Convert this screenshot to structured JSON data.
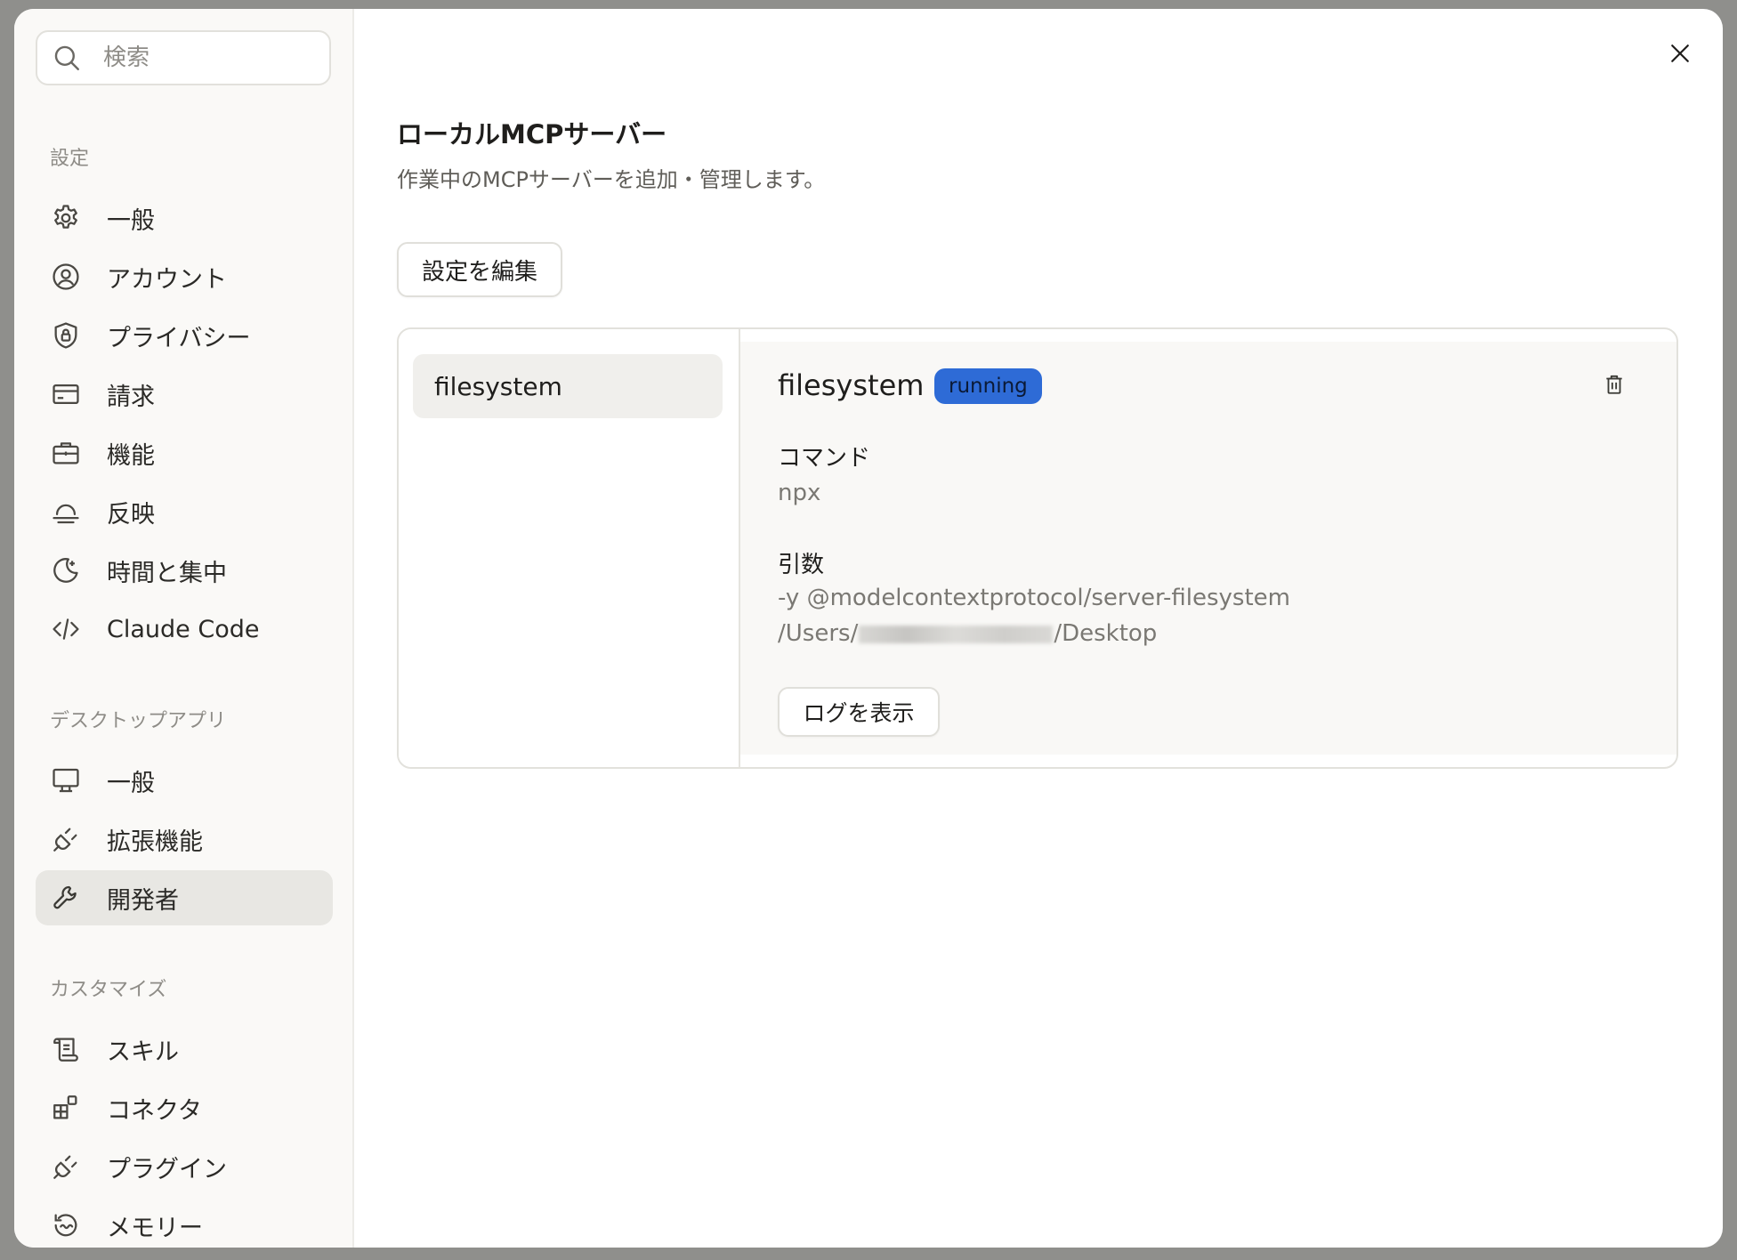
{
  "search": {
    "placeholder": "検索"
  },
  "sidebar": {
    "sections": [
      {
        "title": "設定",
        "items": [
          {
            "label": "一般",
            "icon": "gear-icon"
          },
          {
            "label": "アカウント",
            "icon": "user-circle-icon"
          },
          {
            "label": "プライバシー",
            "icon": "shield-lock-icon"
          },
          {
            "label": "請求",
            "icon": "credit-card-icon"
          },
          {
            "label": "機能",
            "icon": "briefcase-icon"
          },
          {
            "label": "反映",
            "icon": "sunset-icon"
          },
          {
            "label": "時間と集中",
            "icon": "moon-sparkle-icon"
          },
          {
            "label": "Claude Code",
            "icon": "code-icon"
          }
        ]
      },
      {
        "title": "デスクトップアプリ",
        "items": [
          {
            "label": "一般",
            "icon": "monitor-icon"
          },
          {
            "label": "拡張機能",
            "icon": "plug-icon"
          },
          {
            "label": "開発者",
            "icon": "wrench-icon",
            "active": true
          }
        ]
      },
      {
        "title": "カスタマイズ",
        "items": [
          {
            "label": "スキル",
            "icon": "scroll-icon"
          },
          {
            "label": "コネクタ",
            "icon": "blocks-icon"
          },
          {
            "label": "プラグイン",
            "icon": "plug-icon"
          },
          {
            "label": "メモリー",
            "icon": "history-icon"
          }
        ]
      }
    ]
  },
  "main": {
    "title": "ローカルMCPサーバー",
    "description": "作業中のMCPサーバーを追加・管理します。",
    "edit_button": "設定を編集",
    "servers": [
      {
        "name": "filesystem"
      }
    ],
    "detail": {
      "name": "filesystem",
      "status": "running",
      "command_label": "コマンド",
      "command_value": "npx",
      "args_label": "引数",
      "args_line1": "-y @modelcontextprotocol/server-filesystem",
      "args_line2_prefix": "/Users/",
      "args_line2_suffix": "/Desktop",
      "log_button": "ログを表示"
    }
  },
  "colors": {
    "badge": "#2e6bd6",
    "active_nav": "#e8e7e3",
    "backdrop": "#8f8f8c"
  }
}
